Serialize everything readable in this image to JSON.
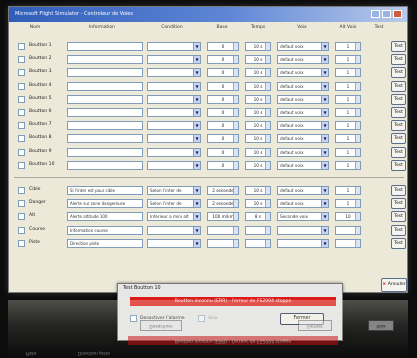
{
  "window": {
    "title": "Microsoft Flight Simulator - Controleur de Voies",
    "min_label": "_",
    "max_label": "□",
    "close_label": "×"
  },
  "headers": {
    "c1": "Nom",
    "c2": "Information",
    "c3": "Condition",
    "c4": "Base",
    "c5": "Temps",
    "c6": "Voix",
    "c7": "Alt Voix",
    "c8": "Test"
  },
  "rows": [
    {
      "name": "Boutton 1",
      "info": "",
      "cond": "",
      "base": "0",
      "temps": "10 s",
      "voix": "defaut voix",
      "alt": "1",
      "test": "Test"
    },
    {
      "name": "Boutton 2",
      "info": "",
      "cond": "",
      "base": "0",
      "temps": "10 s",
      "voix": "defaut voix",
      "alt": "1",
      "test": "Test"
    },
    {
      "name": "Boutton 3",
      "info": "",
      "cond": "",
      "base": "0",
      "temps": "10 s",
      "voix": "defaut voix",
      "alt": "1",
      "test": "Test"
    },
    {
      "name": "Boutton 4",
      "info": "",
      "cond": "",
      "base": "0",
      "temps": "10 s",
      "voix": "defaut voix",
      "alt": "1",
      "test": "Test"
    },
    {
      "name": "Boutton 5",
      "info": "",
      "cond": "",
      "base": "0",
      "temps": "10 s",
      "voix": "defaut voix",
      "alt": "1",
      "test": "Test"
    },
    {
      "name": "Boutton 6",
      "info": "",
      "cond": "",
      "base": "0",
      "temps": "10 s",
      "voix": "defaut voix",
      "alt": "1",
      "test": "Test"
    },
    {
      "name": "Boutton 7",
      "info": "",
      "cond": "",
      "base": "0",
      "temps": "10 s",
      "voix": "defaut voix",
      "alt": "1",
      "test": "Test"
    },
    {
      "name": "Boutton 8",
      "info": "",
      "cond": "",
      "base": "0",
      "temps": "10 s",
      "voix": "defaut voix",
      "alt": "1",
      "test": "Test"
    },
    {
      "name": "Boutton 9",
      "info": "",
      "cond": "",
      "base": "0",
      "temps": "10 s",
      "voix": "defaut voix",
      "alt": "1",
      "test": "Test"
    },
    {
      "name": "Boutton 10",
      "info": "",
      "cond": "",
      "base": "0",
      "temps": "10 s",
      "voix": "defaut voix",
      "alt": "1",
      "test": "Test"
    }
  ],
  "extra_rows": [
    {
      "name": "Cible",
      "info": "Si l'inter est pour cible",
      "cond": "Selon l'inter de",
      "base": "2 seconde",
      "temps": "10 s",
      "voix": "defaut voix",
      "alt": "1",
      "test": "Test"
    },
    {
      "name": "Danger",
      "info": "Alerte sur zone dangereuse",
      "cond": "Selon l'inter de",
      "base": "2 seconde",
      "temps": "10 s",
      "voix": "defaut voix",
      "alt": "1",
      "test": "Test"
    },
    {
      "name": "Alt",
      "info": "Alerte altitude 100",
      "cond": "Inferieur a mini alt",
      "base": "100 m/km",
      "temps": "8 s",
      "voix": "Seconde voix",
      "alt": "10",
      "test": "Test"
    },
    {
      "name": "Course",
      "info": "Information course",
      "cond": "",
      "base": "",
      "temps": "",
      "voix": "",
      "alt": "",
      "test": "Test"
    },
    {
      "name": "Piste",
      "info": "Direction piste",
      "cond": "",
      "base": "",
      "temps": "",
      "voix": "",
      "alt": "",
      "test": "Test"
    }
  ],
  "dialog": {
    "title": "Test Boutton 10",
    "message": "Boutton inconnu (ERR) - l'erreur de FS2004 stoppe",
    "checkbox1_label": "Desactiver l'alarme",
    "checkbox2_label": "Voix",
    "button_label": "Fermer"
  },
  "ok_button": {
    "x_label": "×",
    "label": "Annuler"
  },
  "reflection": {
    "red_text": "Boutton inconnu (ERR) - l'erreur de FS2004 stoppe",
    "btn1": "Desactiver",
    "btn2": "Fermer",
    "btn3": "Voix",
    "lbl1": "Piste",
    "lbl2": "Direction piste"
  },
  "colors": {
    "title_bar": "#2f5eb8",
    "error_red": "#dd1a1a",
    "window_bg": "#ece9d8",
    "backdrop": "#0c0c0c"
  }
}
